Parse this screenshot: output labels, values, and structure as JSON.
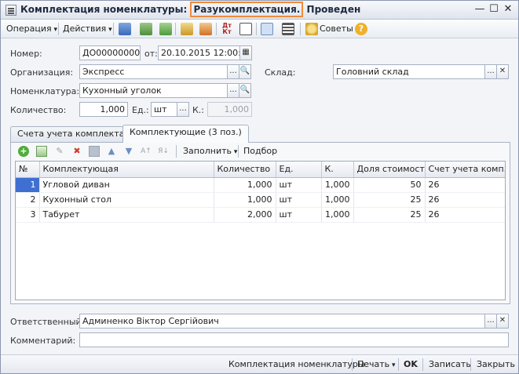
{
  "window": {
    "title_prefix": "Комплектация номенклатуры:",
    "title_highlight": "Разукомплектация.",
    "title_suffix": "Проведен"
  },
  "toolbar": {
    "operation": "Операция",
    "actions": "Действия",
    "tips": "Советы"
  },
  "form": {
    "number_label": "Номер:",
    "number_value": "ДО000000002",
    "date_label": "от:",
    "date_value": "20.10.2015 12:00:00",
    "org_label": "Организация:",
    "org_value": "Экспресс",
    "warehouse_label": "Склад:",
    "warehouse_value": "Головний склад",
    "item_label": "Номенклатура:",
    "item_value": "Кухонный уголок",
    "qty_label": "Количество:",
    "qty_value": "1,000",
    "unit_label": "Ед.:",
    "unit_value": "шт",
    "k_label": "К.:",
    "k_value": "1,000"
  },
  "tabs": [
    {
      "label": "Счета учета комплекта"
    },
    {
      "label": "Комплектующие (3 поз.)"
    }
  ],
  "inner_toolbar": {
    "fill": "Заполнить",
    "pick": "Подбор"
  },
  "table": {
    "headers": [
      "№",
      "Комплектующая",
      "Количество",
      "Ед.",
      "К.",
      "Доля стоимости",
      "Счет учета комп..."
    ],
    "rows": [
      [
        "1",
        "Угловой диван",
        "1,000",
        "шт",
        "1,000",
        "50",
        "26"
      ],
      [
        "2",
        "Кухонный стол",
        "1,000",
        "шт",
        "1,000",
        "25",
        "26"
      ],
      [
        "3",
        "Табурет",
        "2,000",
        "шт",
        "1,000",
        "25",
        "26"
      ]
    ]
  },
  "footer": {
    "responsible_label": "Ответственный:",
    "responsible_value": "Админенко Віктор Сергійович",
    "comment_label": "Комментарий:",
    "comment_value": ""
  },
  "statusbar": {
    "doc_kind": "Комплектация номенклатуры",
    "print": "Печать",
    "ok": "OK",
    "save": "Записать",
    "close": "Закрыть"
  }
}
